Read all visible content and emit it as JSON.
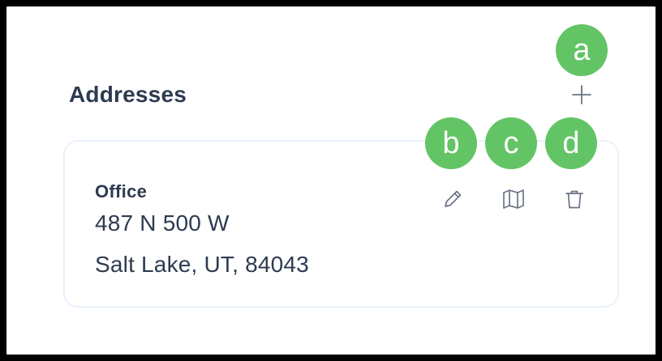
{
  "section": {
    "title": "Addresses"
  },
  "address": {
    "label": "Office",
    "line1": "487 N 500 W",
    "line2": "Salt Lake, UT, 84043"
  },
  "markers": {
    "a": "a",
    "b": "b",
    "c": "c",
    "d": "d"
  },
  "icons": {
    "add": "plus-icon",
    "edit": "pencil-icon",
    "map": "map-icon",
    "delete": "trash-icon"
  },
  "colors": {
    "marker": "#63c466",
    "text": "#2d3b50",
    "icon": "#6b7485",
    "card_border": "#e8f1fd"
  }
}
